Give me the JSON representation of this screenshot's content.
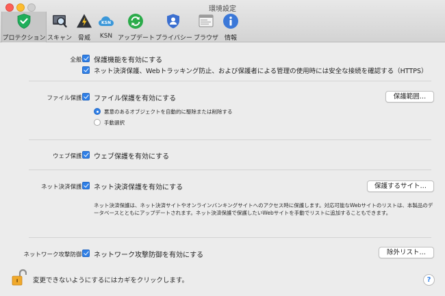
{
  "window": {
    "title": "環境設定"
  },
  "toolbar": {
    "items": [
      {
        "label": "プロテクション",
        "icon": "shield-check-icon",
        "active": true
      },
      {
        "label": "スキャン",
        "icon": "scan-magnifier-icon"
      },
      {
        "label": "脅威",
        "icon": "threat-warning-icon"
      },
      {
        "label": "KSN",
        "icon": "ksn-cloud-icon"
      },
      {
        "label": "アップデート",
        "icon": "update-arrows-icon"
      },
      {
        "label": "プライバシー",
        "icon": "privacy-person-icon"
      },
      {
        "label": "ブラウザ",
        "icon": "browser-window-icon"
      },
      {
        "label": "情報",
        "icon": "info-icon"
      }
    ]
  },
  "general": {
    "label": "全般：",
    "enable_protection": "保護機能を有効にする",
    "secure_connection": "ネット決済保護、Webトラッキング防止、および保護者による管理の使用時には安全な接続を確認する（HTTPS）"
  },
  "file_protection": {
    "label": "ファイル保護：",
    "checkbox": "ファイル保護を有効にする",
    "button": "保護範囲…",
    "radio_auto": "悪意のあるオブジェクトを自動的に駆除または削除する",
    "radio_manual": "手動選択"
  },
  "web_protection": {
    "label": "ウェブ保護：",
    "checkbox": "ウェブ保護を有効にする"
  },
  "safe_money": {
    "label": "ネット決済保護：",
    "checkbox": "ネット決済保護を有効にする",
    "button": "保護するサイト…",
    "description": "ネット決済保護は、ネット決済サイトやオンラインバンキングサイトへのアクセス時に保護します。対応可能なWebサイトのリストは、本製品のデータベースとともにアップデートされます。ネット決済保護で保護したいWebサイトを手動でリストに追加することもできます。"
  },
  "network_attack": {
    "label": "ネットワーク攻撃防御：",
    "checkbox": "ネットワーク攻撃防御を有効にする",
    "button": "除外リスト…"
  },
  "footer": {
    "lock_text": "変更できないようにするにはカギをクリックします。",
    "help": "?"
  },
  "colors": {
    "accent": "#2f7fe6",
    "shield": "#1fae5a",
    "ksn": "#3a97d9",
    "update": "#2bab4a",
    "info": "#3b78d8"
  }
}
